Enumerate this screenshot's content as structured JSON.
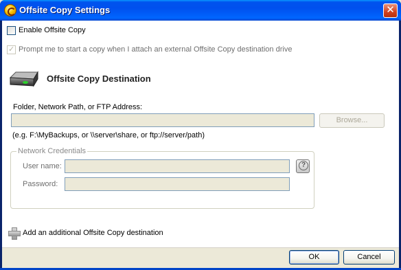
{
  "window": {
    "title": "Offsite Copy Settings",
    "close_label": "✕"
  },
  "enable": {
    "label": "Enable Offsite Copy",
    "checked": false
  },
  "prompt": {
    "label": "Prompt me to start a copy when I  attach an external Offsite Copy destination drive",
    "checked": true,
    "enabled": false
  },
  "destination": {
    "title": "Offsite Copy Destination",
    "icon": "drive-icon",
    "path_label": "Folder, Network Path, or FTP Address:",
    "path_value": "",
    "browse_label": "Browse...",
    "example": "(e.g. F:\\MyBackups, or \\\\server\\share, or ftp://server/path)"
  },
  "credentials": {
    "legend": "Network Credentials",
    "username_label": "User name:",
    "username_value": "",
    "password_label": "Password:",
    "password_value": "",
    "help_icon": "help-icon"
  },
  "add_destination": {
    "label": "Add an additional Offsite Copy destination",
    "icon": "plus-icon"
  },
  "footer": {
    "ok_label": "OK",
    "cancel_label": "Cancel"
  },
  "colors": {
    "title_bar": "#0054e3",
    "field_bg": "#ece9d8",
    "field_border": "#7f9db9",
    "dialog_bg": "#ffffff"
  }
}
